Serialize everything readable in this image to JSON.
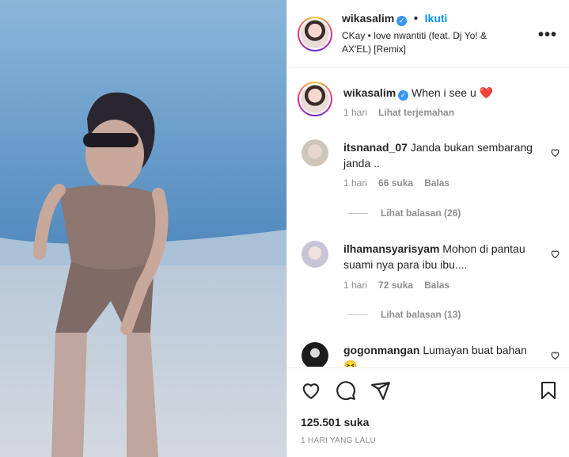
{
  "post": {
    "username": "wikasalim",
    "follow_label": "Ikuti",
    "music": "CKay • love nwantiti (feat. Dj Yo! & AX'EL) [Remix]",
    "caption": "When i see u ❤️",
    "caption_time": "1 hari",
    "translate_label": "Lihat terjemahan"
  },
  "comments": [
    {
      "username": "itsnanad_07",
      "text": "Janda bukan sembarang janda ..",
      "time": "1 hari",
      "likes": "66 suka",
      "reply": "Balas",
      "view_replies": "Lihat balasan (26)"
    },
    {
      "username": "ilhamansyarisyam",
      "text": "Mohon di pantau suami nya para ibu ibu....",
      "time": "1 hari",
      "likes": "72 suka",
      "reply": "Balas",
      "view_replies": "Lihat balasan (13)"
    },
    {
      "username": "gogonmangan",
      "text": "Lumayan buat bahan 😝"
    }
  ],
  "footer": {
    "likes": "125.501 suka",
    "time": "1 HARI YANG LALU"
  },
  "colors": {
    "accent": "#0095f6",
    "verified": "#3897f0",
    "muted": "#8e8e8e"
  },
  "icons": [
    "verified-badge-icon",
    "more-options-icon",
    "heart-icon",
    "comment-icon",
    "share-icon",
    "bookmark-icon"
  ]
}
